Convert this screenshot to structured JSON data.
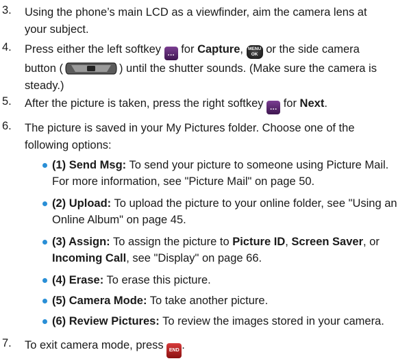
{
  "steps": [
    {
      "num": "3.",
      "text1": "Using the phone’s main LCD as a viewfinder, aim the camera lens at",
      "text2": "your subject."
    },
    {
      "num": "4.",
      "a": "Press either the left softkey",
      "capture": "Capture",
      "b": ",",
      "c": "or the side camera",
      "d": "button (",
      "e": ") until the shutter sounds. (Make sure the camera is",
      "f": "steady.)"
    },
    {
      "num": "5.",
      "a": "After the picture is taken, press the right softkey",
      "b": "for",
      "next": "Next",
      "c": "."
    },
    {
      "num": "6.",
      "text1": "The picture is saved in your My Pictures folder. Choose one of the",
      "text2": "following options:"
    },
    {
      "num": "7.",
      "a": "To exit camera mode, press",
      "b": "."
    }
  ],
  "options": [
    {
      "label": "(1) Send Msg:",
      "text1": " To send your picture to someone using Picture Mail.",
      "text2": "For more information, see \"Picture Mail\" on page 50."
    },
    {
      "label": "(2) Upload:",
      "text1": " To upload the picture to your online folder, see \"Using an",
      "text2": "Online Album\" on page 45."
    },
    {
      "label": "(3) Assign:",
      "text1a": " To assign the picture to ",
      "pid": "Picture ID",
      "text1b": ", ",
      "ss": "Screen Saver",
      "text1c": ", or",
      "ic": "Incoming Call",
      "text2": ", see \"Display\" on page 66."
    },
    {
      "label": "(4) Erase:",
      "text1": " To erase this picture."
    },
    {
      "label": "(5) Camera Mode:",
      "text1": " To take another picture."
    },
    {
      "label": "(6) Review Pictures:",
      "text1": " To review the images stored in your camera."
    }
  ],
  "icons": {
    "softkey": "…",
    "menu_top": "MENU",
    "menu_bottom": "OK",
    "end_key": "END"
  },
  "colors": {
    "bullet": "#2a8fd6",
    "softkey": "#5a2470",
    "end_key": "#c02020"
  }
}
